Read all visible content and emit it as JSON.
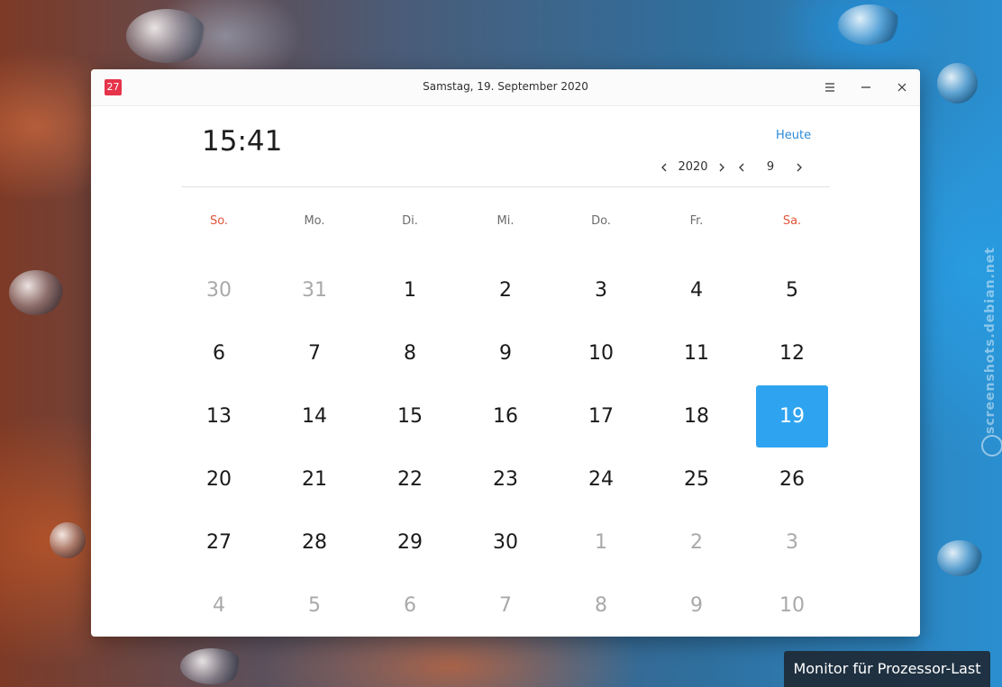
{
  "window": {
    "title": "Samstag, 19. September 2020",
    "app_icon_text": "27"
  },
  "header": {
    "clock": "15:41",
    "today_label": "Heute",
    "year": "2020",
    "month": "9"
  },
  "weekdays": [
    {
      "label": "So.",
      "weekend": true
    },
    {
      "label": "Mo.",
      "weekend": false
    },
    {
      "label": "Di.",
      "weekend": false
    },
    {
      "label": "Mi.",
      "weekend": false
    },
    {
      "label": "Do.",
      "weekend": false
    },
    {
      "label": "Fr.",
      "weekend": false
    },
    {
      "label": "Sa.",
      "weekend": true
    }
  ],
  "days": [
    {
      "d": "30",
      "other": true
    },
    {
      "d": "31",
      "other": true
    },
    {
      "d": "1"
    },
    {
      "d": "2"
    },
    {
      "d": "3"
    },
    {
      "d": "4"
    },
    {
      "d": "5"
    },
    {
      "d": "6"
    },
    {
      "d": "7"
    },
    {
      "d": "8"
    },
    {
      "d": "9"
    },
    {
      "d": "10"
    },
    {
      "d": "11"
    },
    {
      "d": "12"
    },
    {
      "d": "13"
    },
    {
      "d": "14"
    },
    {
      "d": "15"
    },
    {
      "d": "16"
    },
    {
      "d": "17"
    },
    {
      "d": "18"
    },
    {
      "d": "19",
      "selected": true
    },
    {
      "d": "20"
    },
    {
      "d": "21"
    },
    {
      "d": "22"
    },
    {
      "d": "23"
    },
    {
      "d": "24"
    },
    {
      "d": "25"
    },
    {
      "d": "26"
    },
    {
      "d": "27"
    },
    {
      "d": "28"
    },
    {
      "d": "29"
    },
    {
      "d": "30"
    },
    {
      "d": "1",
      "other": true
    },
    {
      "d": "2",
      "other": true
    },
    {
      "d": "3",
      "other": true
    },
    {
      "d": "4",
      "other": true
    },
    {
      "d": "5",
      "other": true
    },
    {
      "d": "6",
      "other": true
    },
    {
      "d": "7",
      "other": true
    },
    {
      "d": "8",
      "other": true
    },
    {
      "d": "9",
      "other": true
    },
    {
      "d": "10",
      "other": true
    }
  ],
  "tooltip": "Monitor für Prozessor-Last",
  "watermark": "screenshots.debian.net",
  "colors": {
    "accent": "#2ea4f0",
    "weekend": "#e0543a",
    "link": "#2b8ad8",
    "other_month": "#a9a9a9"
  },
  "icons": {
    "menu": "hamburger-icon",
    "minimize": "minimize-icon",
    "close": "close-icon",
    "prev": "chevron-left-icon",
    "next": "chevron-right-icon"
  }
}
